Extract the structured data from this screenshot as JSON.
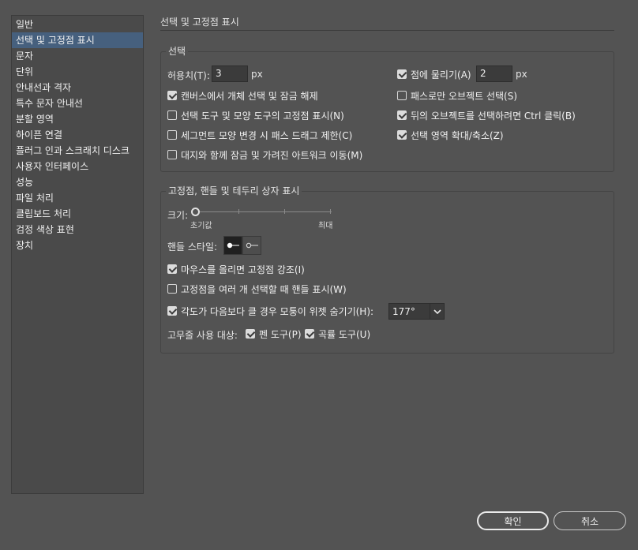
{
  "sidebar": {
    "items": [
      {
        "label": "일반"
      },
      {
        "label": "선택 및 고정점 표시",
        "selected": true
      },
      {
        "label": "문자"
      },
      {
        "label": "단위"
      },
      {
        "label": "안내선과 격자"
      },
      {
        "label": "특수 문자 안내선"
      },
      {
        "label": "분할 영역"
      },
      {
        "label": "하이픈 연결"
      },
      {
        "label": "플러그 인과 스크래치 디스크"
      },
      {
        "label": "사용자 인터페이스"
      },
      {
        "label": "성능"
      },
      {
        "label": "파일 처리"
      },
      {
        "label": "클립보드 처리"
      },
      {
        "label": "검정 색상 표현"
      },
      {
        "label": "장치"
      }
    ]
  },
  "page_title": "선택 및 고정점 표시",
  "selection": {
    "legend": "선택",
    "tolerance_label": "허용치(T):",
    "tolerance_value": "3",
    "tolerance_unit": "px",
    "snap_label": "점에 물리기(A)",
    "snap_checked": true,
    "snap_value": "2",
    "snap_unit": "px",
    "opt_canvas_label": "캔버스에서 개체 선택 및 잠금 해제",
    "opt_canvas_checked": true,
    "opt_path_only_label": "패스로만 오브젝트 선택(S)",
    "opt_path_only_checked": false,
    "opt_anchor_display_label": "선택 도구 및 모양 도구의 고정점 표시(N)",
    "opt_anchor_display_checked": false,
    "opt_ctrl_click_label": "뒤의 오브젝트를 선택하려면 Ctrl 클릭(B)",
    "opt_ctrl_click_checked": true,
    "opt_segment_label": "세그먼트 모양 변경 시 패스 드래그 제한(C)",
    "opt_segment_checked": false,
    "opt_zoom_label": "선택 영역 확대/축소(Z)",
    "opt_zoom_checked": true,
    "opt_artboard_label": "대지와 함께 잠금 및 가려진 아트워크 이동(M)",
    "opt_artboard_checked": false
  },
  "anchors": {
    "legend": "고정점, 핸들 및 테두리 상자 표시",
    "size_label": "크기:",
    "size_value": 0,
    "size_min_label": "초기값",
    "size_max_label": "최대",
    "handle_style_label": "핸들 스타일:",
    "handle_style_selected": "solid",
    "opt_highlight_label": "마우스를 올리면 고정점 강조(I)",
    "opt_highlight_checked": true,
    "opt_multi_handles_label": "고정점을 여러 개 선택할 때 핸들 표시(W)",
    "opt_multi_handles_checked": false,
    "opt_hide_widget_label": "각도가 다음보다 클 경우 모퉁이 위젯 숨기기(H):",
    "opt_hide_widget_checked": true,
    "angle_value": "177°",
    "rubber_band_label": "고무줄 사용 대상:",
    "pen_tool_label": "펜 도구(P)",
    "pen_tool_checked": true,
    "curvature_tool_label": "곡률 도구(U)",
    "curvature_tool_checked": true
  },
  "buttons": {
    "ok": "확인",
    "cancel": "취소"
  },
  "colors": {
    "background": "#535353",
    "sidebar_selected": "#46607e"
  }
}
